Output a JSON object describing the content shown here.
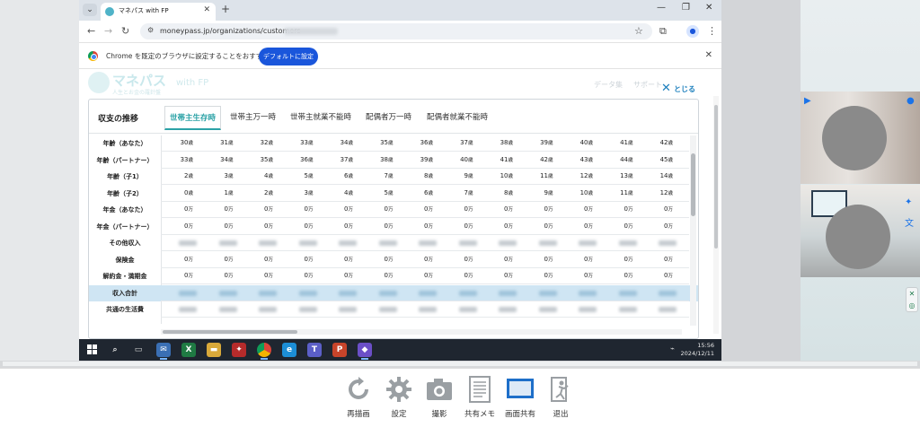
{
  "browser": {
    "tab_title": "マネパス with FP",
    "url": "moneypass.jp/organizations/customers",
    "infobar_text": "Chrome を既定のブラウザに設定することをおすすめします",
    "infobar_button": "デフォルトに設定"
  },
  "site": {
    "brand_name": "マネパス",
    "brand_suffix": "with FP",
    "brand_tagline": "人生とお金の羅針盤",
    "nav": [
      "データ集",
      "サポート"
    ],
    "close_label": "とじる"
  },
  "modal": {
    "title": "収支の推移",
    "tabs": [
      "世帯主生存時",
      "世帯主万一時",
      "世帯主就業不能時",
      "配偶者万一時",
      "配偶者就業不能時"
    ],
    "active_tab": "世帯主生存時"
  },
  "table": {
    "rows": [
      {
        "label": "年齢（あなた）",
        "values": [
          "30",
          "31",
          "32",
          "33",
          "34",
          "35",
          "36",
          "37",
          "38",
          "39",
          "40",
          "41",
          "42"
        ],
        "unit": "歳"
      },
      {
        "label": "年齢（パートナー）",
        "values": [
          "33",
          "34",
          "35",
          "36",
          "37",
          "38",
          "39",
          "40",
          "41",
          "42",
          "43",
          "44",
          "45"
        ],
        "unit": "歳"
      },
      {
        "label": "年齢（子1）",
        "values": [
          "2",
          "3",
          "4",
          "5",
          "6",
          "7",
          "8",
          "9",
          "10",
          "11",
          "12",
          "13",
          "14"
        ],
        "unit": "歳"
      },
      {
        "label": "年齢（子2）",
        "values": [
          "0",
          "1",
          "2",
          "3",
          "4",
          "5",
          "6",
          "7",
          "8",
          "9",
          "10",
          "11",
          "12"
        ],
        "unit": "歳"
      },
      {
        "label": "年金（あなた）",
        "values": [
          "0",
          "0",
          "0",
          "0",
          "0",
          "0",
          "0",
          "0",
          "0",
          "0",
          "0",
          "0",
          "0"
        ],
        "unit": "万"
      },
      {
        "label": "年金（パートナー）",
        "values": [
          "0",
          "0",
          "0",
          "0",
          "0",
          "0",
          "0",
          "0",
          "0",
          "0",
          "0",
          "0",
          "0"
        ],
        "unit": "万"
      },
      {
        "label": "その他収入",
        "values": [],
        "unit": ""
      },
      {
        "label": "保険金",
        "values": [
          "0",
          "0",
          "0",
          "0",
          "0",
          "0",
          "0",
          "0",
          "0",
          "0",
          "0",
          "0",
          "0"
        ],
        "unit": "万"
      },
      {
        "label": "解約金・満期金",
        "values": [
          "0",
          "0",
          "0",
          "0",
          "0",
          "0",
          "0",
          "0",
          "0",
          "0",
          "0",
          "0",
          "0"
        ],
        "unit": "万"
      },
      {
        "label": "収入合計",
        "values": [],
        "unit": "",
        "highlight": true
      },
      {
        "label": "共通の生活費",
        "values": [],
        "unit": ""
      }
    ]
  },
  "taskbar": {
    "time": "15:56",
    "date": "2024/12/11"
  },
  "bottom_bar": {
    "items": [
      "再描画",
      "設定",
      "撮影",
      "共有メモ",
      "画面共有",
      "退出"
    ]
  },
  "colors": {
    "accent": "#2ba2a6",
    "chrome_button": "#1a56db",
    "summary_row": "#cfe5f3"
  }
}
